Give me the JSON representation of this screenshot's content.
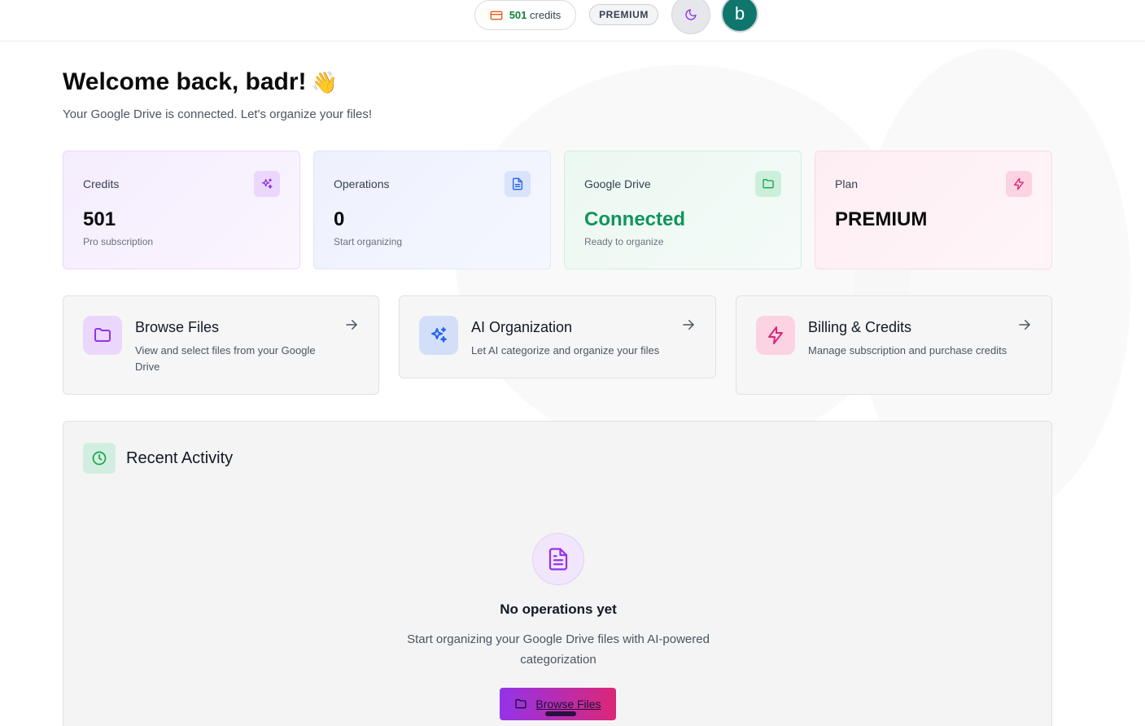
{
  "header": {
    "credits_number": "501",
    "credits_suffix": "credits",
    "plan_badge": "PREMIUM",
    "avatar_initial": "b"
  },
  "welcome": {
    "title": "Welcome back, badr!",
    "emoji": "👋",
    "subtitle": "Your Google Drive is connected. Let's organize your files!"
  },
  "stats": [
    {
      "label": "Credits",
      "value": "501",
      "note": "Pro subscription",
      "icon": "sparkles-icon"
    },
    {
      "label": "Operations",
      "value": "0",
      "note": "Start organizing",
      "icon": "document-icon"
    },
    {
      "label": "Google Drive",
      "value": "Connected",
      "note": "Ready to organize",
      "icon": "folder-icon"
    },
    {
      "label": "Plan",
      "value": "PREMIUM",
      "note": "",
      "icon": "lightning-icon"
    }
  ],
  "actions": [
    {
      "title": "Browse Files",
      "desc": "View and select files from your Google Drive",
      "icon": "folder-icon"
    },
    {
      "title": "AI Organization",
      "desc": "Let AI categorize and organize your files",
      "icon": "sparkles-icon"
    },
    {
      "title": "Billing & Credits",
      "desc": "Manage subscription and purchase credits",
      "icon": "lightning-icon"
    }
  ],
  "recent": {
    "title": "Recent Activity",
    "empty_title": "No operations yet",
    "empty_desc": "Start organizing your Google Drive files with AI-powered categorization",
    "cta_label": "Browse Files"
  },
  "colors": {
    "purple": "#9333ea",
    "blue": "#2563eb",
    "green": "#16a34a",
    "pink": "#db2777",
    "avatar": "#0f766e"
  }
}
